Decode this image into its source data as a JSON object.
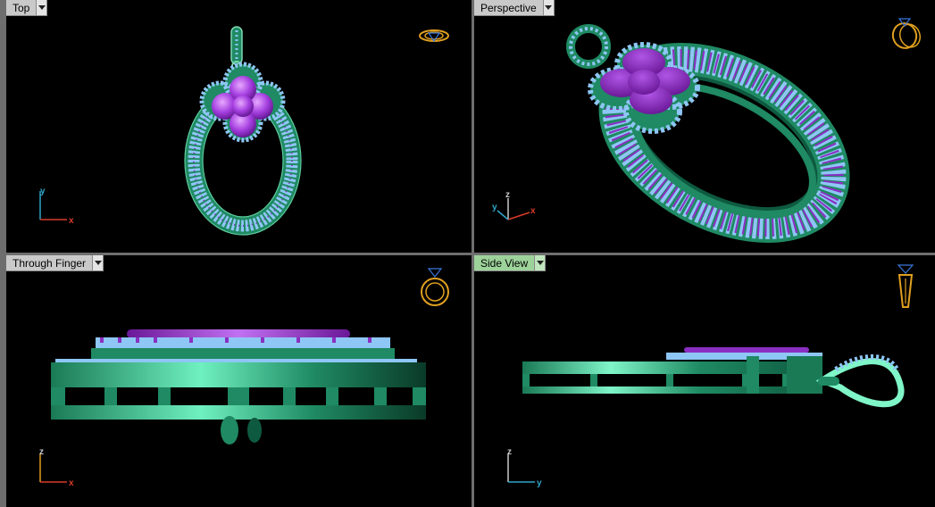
{
  "viewports": {
    "top": {
      "title": "Top",
      "axes": {
        "h": "x",
        "v": "y"
      }
    },
    "perspective": {
      "title": "Perspective",
      "axes": {
        "a": "x",
        "b": "y",
        "c": "z"
      }
    },
    "through_finger": {
      "title": "Through Finger",
      "axes": {
        "h": "x",
        "v": "z"
      }
    },
    "side_view": {
      "title": "Side View",
      "axes": {
        "h": "y",
        "v": "z"
      },
      "active": true
    }
  },
  "icons": {
    "top": "ring-top-icon",
    "perspective": "ring-perspective-icon",
    "through_finger": "ring-front-icon",
    "side_view": "ring-side-icon"
  },
  "colors": {
    "background": "#000000",
    "metal": "#1f8a63",
    "gem": "#7fb4f0",
    "flower": "#8b2fc2",
    "axis_x": "#d83a2a",
    "axis_y": "#2fa6c9",
    "axis_z": "#c8c8c8",
    "ring_icon": "#e0a020",
    "active_tab": "#9dd39a"
  }
}
